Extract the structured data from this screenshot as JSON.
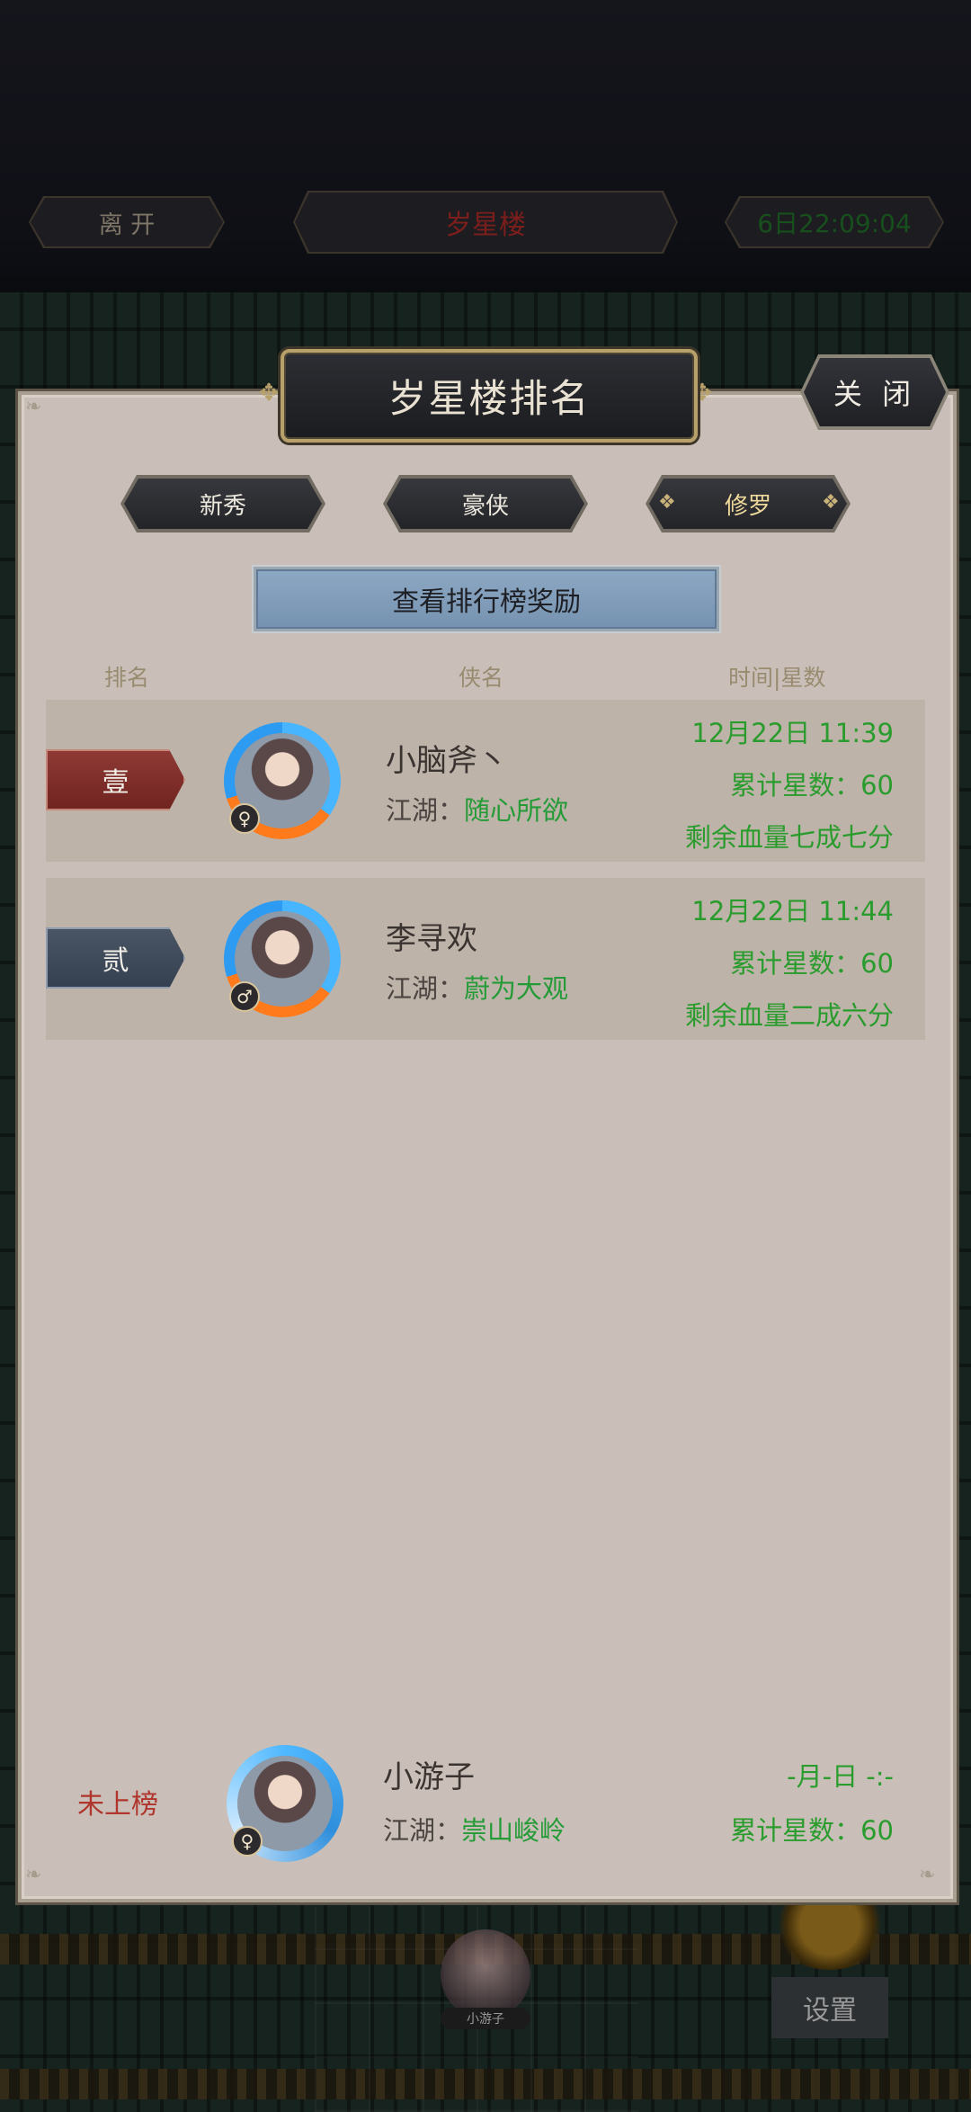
{
  "top_bar": {
    "leave_label": "离 开",
    "location_label": "岁星楼",
    "countdown": "6日22:09:04"
  },
  "panel": {
    "title": "岁星楼排名",
    "close_label": "关 闭",
    "tabs": [
      {
        "label": "新秀",
        "active": false
      },
      {
        "label": "豪侠",
        "active": false
      },
      {
        "label": "修罗",
        "active": true
      }
    ],
    "reward_button": "查看排行榜奖励",
    "columns": {
      "rank": "排名",
      "name": "侠名",
      "time_stars": "时间|星数"
    },
    "rows": [
      {
        "rank": "壹",
        "rank_color": "#7d2d28",
        "gender": "♀",
        "name": "小脑斧丶",
        "jianghu_label": "江湖：",
        "jianghu_value": "随心所欲",
        "time": "12月22日 11:39",
        "stars": "累计星数：60",
        "hp": "剩余血量七成七分"
      },
      {
        "rank": "贰",
        "rank_color": "#3d4858",
        "gender": "♂",
        "name": "李寻欢",
        "jianghu_label": "江湖：",
        "jianghu_value": "蔚为大观",
        "time": "12月22日 11:44",
        "stars": "累计星数：60",
        "hp": "剩余血量二成六分"
      }
    ],
    "self_row": {
      "rank": "未上榜",
      "gender": "♀",
      "name": "小游子",
      "jianghu_label": "江湖：",
      "jianghu_value": "崇山峻岭",
      "time": "-月-日 -:-",
      "stars": "累计星数：60"
    }
  },
  "scene": {
    "settings_label": "设置",
    "avatar_name": "小游子"
  },
  "colors": {
    "panel_bg": "#c9bfb8",
    "row_bg": "#bdb3a9",
    "accent_green": "#2a9c2d",
    "accent_gold": "#b8a06a",
    "rank_red": "#b0352c"
  }
}
